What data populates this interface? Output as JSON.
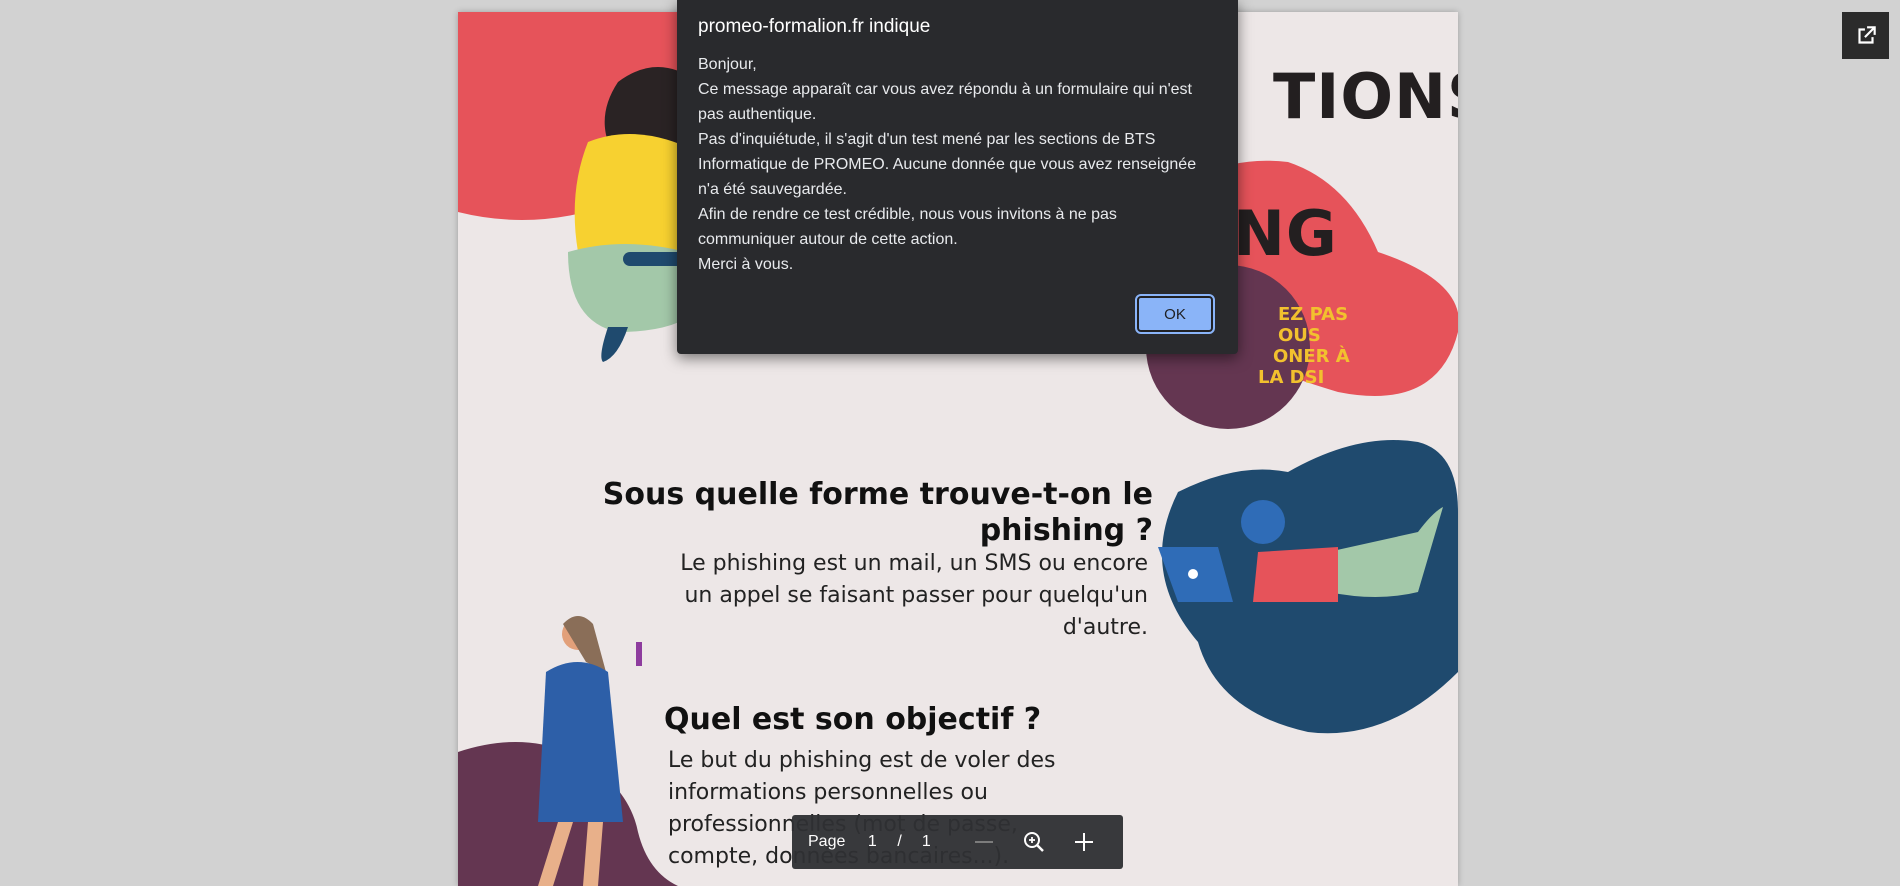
{
  "document": {
    "title_fragment_1": "TIONS",
    "title_fragment_2": "NG",
    "circle_text": [
      "EZ PAS",
      "OUS",
      "ONER À",
      "LA DSI"
    ],
    "section1": {
      "heading_line1": "Sous quelle forme trouve-t-on le",
      "heading_line2": "phishing ?",
      "body": [
        "Le phishing est un mail, un SMS ou encore",
        "un appel se faisant passer pour quelqu'un",
        "d'autre."
      ]
    },
    "section2": {
      "heading": "Quel est son objectif ?",
      "body": [
        "Le but du phishing est de voler des",
        "informations personnelles ou",
        "professionnelles (mot de passe,",
        "compte, données bancaires...)."
      ]
    }
  },
  "dialog": {
    "title": "promeo-formalion.fr indique",
    "message": "Bonjour,\n Ce message apparaît car vous avez répondu à un formulaire qui n'est pas authentique.\n Pas d'inquiétude, il s'agit d'un test mené par les sections de BTS Informatique de PROMEO. Aucune donnée que vous avez renseignée n'a été sauvegardée.\n Afin de rendre ce test crédible, nous vous invitons à ne pas communiquer autour de cette action.\n Merci à vous.",
    "ok_label": "OK"
  },
  "toolbar": {
    "page_label": "Page",
    "current_page": "1",
    "separator": "/",
    "total_pages": "1",
    "icons": [
      "zoom-out-icon",
      "zoom-reset-icon",
      "zoom-in-icon"
    ]
  },
  "colors": {
    "red": "#e6535a",
    "yellow": "#f7d130",
    "navy": "#1f4a6e",
    "plum": "#643651",
    "page_bg": "#ede7e7",
    "dialog_bg": "#292a2d",
    "ok_button": "#8ab4f8"
  },
  "icons": [
    "open-external-icon"
  ]
}
